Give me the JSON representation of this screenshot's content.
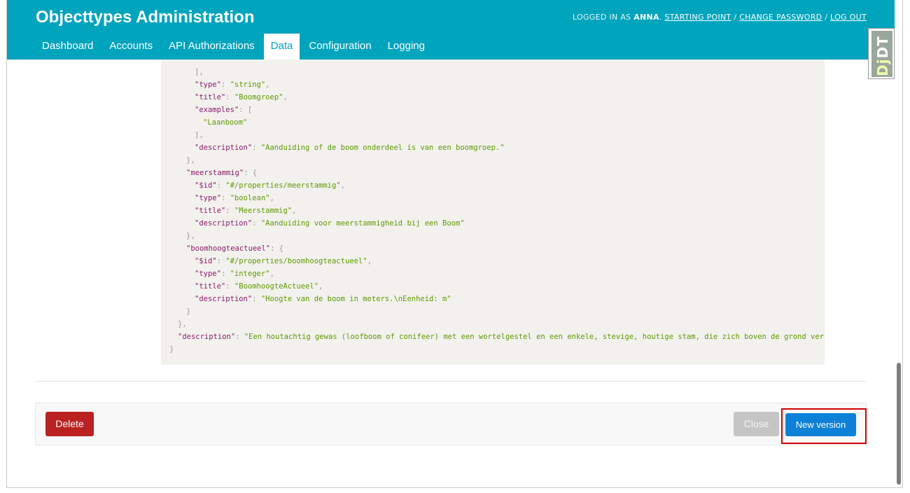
{
  "header": {
    "title": "Objecttypes Administration",
    "user_tools": {
      "logged_in_prefix": "LOGGED IN AS",
      "username": "ANNA",
      "period": ".",
      "links": [
        "STARTING POINT",
        "CHANGE PASSWORD",
        "LOG OUT"
      ],
      "separator": " / "
    },
    "nav_tabs": [
      {
        "label": "Dashboard",
        "active": false
      },
      {
        "label": "Accounts",
        "active": false
      },
      {
        "label": "API Authorizations",
        "active": false
      },
      {
        "label": "Data",
        "active": true
      },
      {
        "label": "Configuration",
        "active": false
      },
      {
        "label": "Logging",
        "active": false
      }
    ]
  },
  "json_schema_lines": [
    [
      {
        "t": "p",
        "v": "],"
      }
    ],
    [
      {
        "t": "k",
        "v": "\"type\""
      },
      {
        "t": "p",
        "v": ": "
      },
      {
        "t": "s",
        "v": "\"string\""
      },
      {
        "t": "p",
        "v": ","
      }
    ],
    [
      {
        "t": "k",
        "v": "\"title\""
      },
      {
        "t": "p",
        "v": ": "
      },
      {
        "t": "s",
        "v": "\"Boomgroep\""
      },
      {
        "t": "p",
        "v": ","
      }
    ],
    [
      {
        "t": "k",
        "v": "\"examples\""
      },
      {
        "t": "p",
        "v": ": ["
      }
    ],
    [
      {
        "t": "s",
        "v": "\"Laanboom\""
      }
    ],
    [
      {
        "t": "p",
        "v": "],"
      }
    ],
    [
      {
        "t": "k",
        "v": "\"description\""
      },
      {
        "t": "p",
        "v": ": "
      },
      {
        "t": "s",
        "v": "\"Aanduiding of de boom onderdeel is van een boomgroep.\""
      }
    ],
    [
      {
        "t": "p",
        "v": "},"
      }
    ],
    [
      {
        "t": "k",
        "v": "\"meerstammig\""
      },
      {
        "t": "p",
        "v": ": {"
      }
    ],
    [
      {
        "t": "k",
        "v": "\"$id\""
      },
      {
        "t": "p",
        "v": ": "
      },
      {
        "t": "s",
        "v": "\"#/properties/meerstammig\""
      },
      {
        "t": "p",
        "v": ","
      }
    ],
    [
      {
        "t": "k",
        "v": "\"type\""
      },
      {
        "t": "p",
        "v": ": "
      },
      {
        "t": "s",
        "v": "\"boolean\""
      },
      {
        "t": "p",
        "v": ","
      }
    ],
    [
      {
        "t": "k",
        "v": "\"title\""
      },
      {
        "t": "p",
        "v": ": "
      },
      {
        "t": "s",
        "v": "\"Meerstammig\""
      },
      {
        "t": "p",
        "v": ","
      }
    ],
    [
      {
        "t": "k",
        "v": "\"description\""
      },
      {
        "t": "p",
        "v": ": "
      },
      {
        "t": "s",
        "v": "\"Aanduiding voor meerstammigheid bij een Boom\""
      }
    ],
    [
      {
        "t": "p",
        "v": "},"
      }
    ],
    [
      {
        "t": "k",
        "v": "\"boomhoogteactueel\""
      },
      {
        "t": "p",
        "v": ": {"
      }
    ],
    [
      {
        "t": "k",
        "v": "\"$id\""
      },
      {
        "t": "p",
        "v": ": "
      },
      {
        "t": "s",
        "v": "\"#/properties/boomhoogteactueel\""
      },
      {
        "t": "p",
        "v": ","
      }
    ],
    [
      {
        "t": "k",
        "v": "\"type\""
      },
      {
        "t": "p",
        "v": ": "
      },
      {
        "t": "s",
        "v": "\"integer\""
      },
      {
        "t": "p",
        "v": ","
      }
    ],
    [
      {
        "t": "k",
        "v": "\"title\""
      },
      {
        "t": "p",
        "v": ": "
      },
      {
        "t": "s",
        "v": "\"BoomhoogteActueel\""
      },
      {
        "t": "p",
        "v": ","
      }
    ],
    [
      {
        "t": "k",
        "v": "\"description\""
      },
      {
        "t": "p",
        "v": ": "
      },
      {
        "t": "s",
        "v": "\"Hoogte van de boom in meters.\\nEenheid: m\""
      }
    ],
    [
      {
        "t": "p",
        "v": "}"
      }
    ],
    [
      {
        "t": "p",
        "v": "},"
      }
    ],
    [
      {
        "t": "k",
        "v": "\"description\""
      },
      {
        "t": "p",
        "v": ": "
      },
      {
        "t": "s",
        "v": "\"Een houtachtig gewas (loofboom of conifeer) met een wortelgestel en een enkele, stevige, houtige stam, die zich boven de grond vertakt.\""
      }
    ],
    [
      {
        "t": "p",
        "v": "}"
      }
    ]
  ],
  "actions": {
    "delete_label": "Delete",
    "close_label": "Close",
    "new_version_label": "New version"
  },
  "debug_toolbar": {
    "label_dj": "Dj",
    "label_dt": "DT"
  },
  "colors": {
    "header_bg": "#00a4bd",
    "delete_bg": "#ba2121",
    "new_version_bg": "#0d80d8",
    "json_key": "#8a1b6a",
    "json_string": "#5d9a00",
    "highlight_border": "#d00000"
  }
}
